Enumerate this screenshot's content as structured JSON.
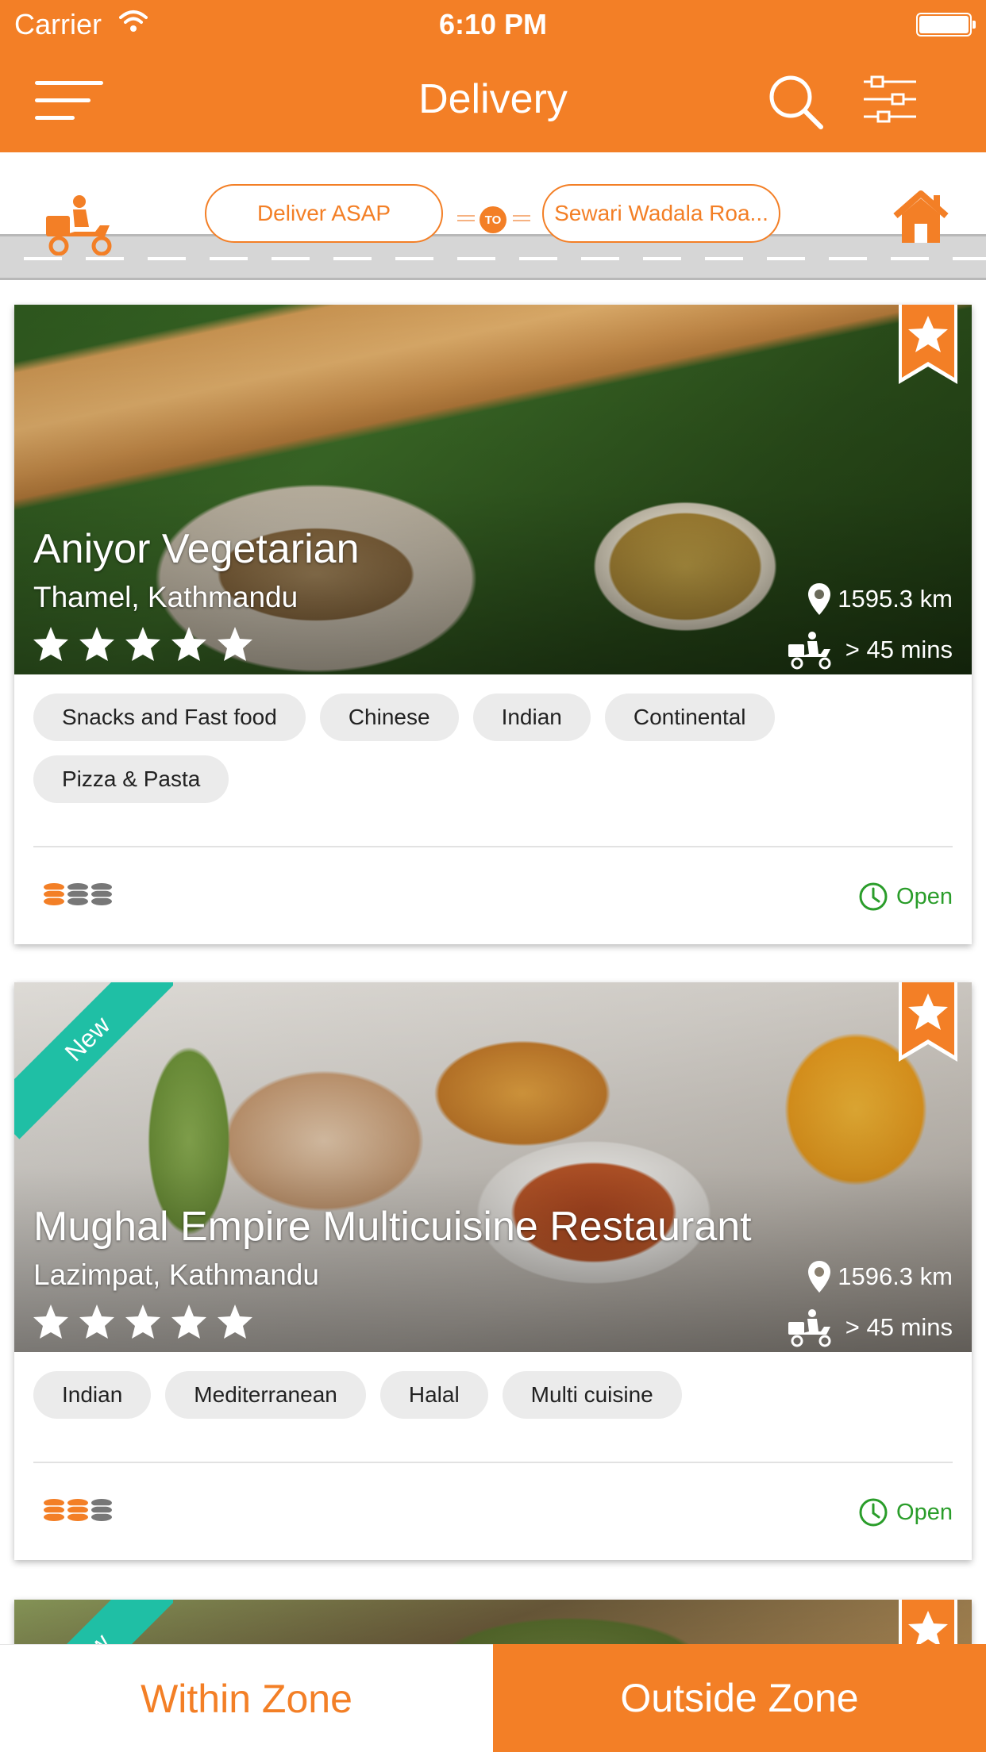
{
  "status_bar": {
    "carrier": "Carrier",
    "time": "6:10 PM"
  },
  "nav": {
    "title": "Delivery"
  },
  "delivery": {
    "when": "Deliver ASAP",
    "to_label": "TO",
    "address": "Sewari Wadala Roa..."
  },
  "restaurants": [
    {
      "name": "Aniyor Vegetarian",
      "location": "Thamel, Kathmandu",
      "rating": 5,
      "distance": "1595.3 km",
      "eta": "> 45 mins",
      "is_new": false,
      "bookmarked": true,
      "cuisines": [
        "Snacks and Fast food",
        "Chinese",
        "Indian",
        "Continental",
        "Pizza & Pasta"
      ],
      "price_level": 1,
      "status": "Open"
    },
    {
      "name": "Mughal Empire Multicuisine Restaurant",
      "location": "Lazimpat, Kathmandu",
      "rating": 5,
      "distance": "1596.3 km",
      "eta": "> 45 mins",
      "is_new": true,
      "new_label": "New",
      "bookmarked": true,
      "cuisines": [
        "Indian",
        "Mediterranean",
        "Halal",
        "Multi cuisine"
      ],
      "price_level": 2,
      "status": "Open"
    },
    {
      "is_new": true,
      "new_label": "New",
      "bookmarked": true
    }
  ],
  "tabs": {
    "within": "Within Zone",
    "outside": "Outside Zone",
    "active": "outside"
  },
  "colors": {
    "accent": "#f37f26",
    "new_ribbon": "#1fbfa5",
    "open_green": "#2a9d2a",
    "tag_bg": "#ebebeb"
  }
}
